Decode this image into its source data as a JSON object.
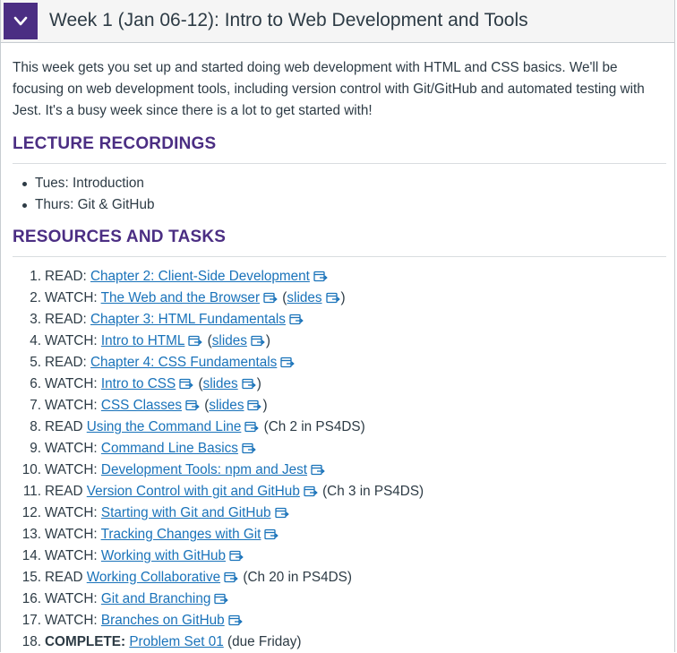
{
  "module": {
    "title": "Week 1 (Jan 06-12): Intro to Web Development and Tools",
    "intro": "This week gets you set up and started doing web development with HTML and CSS basics. We'll be focusing on web development tools, including version control with Git/GitHub and automated testing with Jest. It's a busy week since there is a lot to get started with!"
  },
  "lecture": {
    "heading": "LECTURE RECORDINGS",
    "items": [
      "Tues: Introduction",
      "Thurs: Git & GitHub"
    ]
  },
  "resources": {
    "heading": "RESOURCES AND TASKS",
    "items": [
      {
        "num": "1.",
        "prefix": "READ: ",
        "link": "Chapter 2: Client-Side Development",
        "slides": null,
        "suffix": ""
      },
      {
        "num": "2.",
        "prefix": "WATCH: ",
        "link": "The Web and the Browser",
        "slides": "slides",
        "suffix": ""
      },
      {
        "num": "3.",
        "prefix": "READ: ",
        "link": "Chapter 3: HTML Fundamentals",
        "slides": null,
        "suffix": ""
      },
      {
        "num": "4.",
        "prefix": "WATCH: ",
        "link": "Intro to HTML",
        "slides": "slides",
        "suffix": ""
      },
      {
        "num": "5.",
        "prefix": "READ: ",
        "link": "Chapter 4: CSS Fundamentals",
        "slides": null,
        "suffix": ""
      },
      {
        "num": "6.",
        "prefix": "WATCH: ",
        "link": "Intro to CSS",
        "slides": "slides",
        "suffix": ""
      },
      {
        "num": "7.",
        "prefix": "WATCH: ",
        "link": "CSS Classes",
        "slides": "slides",
        "suffix": ""
      },
      {
        "num": "8.",
        "prefix": "READ ",
        "link": "Using the Command Line",
        "slides": null,
        "suffix": "(Ch 2 in PS4DS)"
      },
      {
        "num": "9.",
        "prefix": "WATCH: ",
        "link": "Command Line Basics",
        "slides": null,
        "suffix": ""
      },
      {
        "num": "10.",
        "prefix": "WATCH: ",
        "link": "Development Tools: npm and Jest",
        "slides": null,
        "suffix": ""
      },
      {
        "num": "11.",
        "prefix": "READ ",
        "link": "Version Control with git and GitHub",
        "slides": null,
        "suffix": "(Ch 3 in PS4DS)"
      },
      {
        "num": "12.",
        "prefix": "WATCH: ",
        "link": "Starting with Git and GitHub",
        "slides": null,
        "suffix": ""
      },
      {
        "num": "13.",
        "prefix": "WATCH: ",
        "link": "Tracking Changes with Git",
        "slides": null,
        "suffix": ""
      },
      {
        "num": "14.",
        "prefix": "WATCH: ",
        "link": "Working with GitHub",
        "slides": null,
        "suffix": ""
      },
      {
        "num": "15.",
        "prefix": "READ ",
        "link": "Working Collaborative",
        "slides": null,
        "suffix": "(Ch 20 in PS4DS)"
      },
      {
        "num": "16.",
        "prefix": "WATCH: ",
        "link": "Git and Branching",
        "slides": null,
        "suffix": ""
      },
      {
        "num": "17.",
        "prefix": "WATCH: ",
        "link": "Branches on GitHub",
        "slides": null,
        "suffix": ""
      },
      {
        "num": "18.",
        "prefix": "COMPLETE: ",
        "bold_prefix": true,
        "link": "Problem Set 01",
        "slides": null,
        "suffix": "(due Friday)",
        "no_ext": true
      }
    ]
  },
  "colors": {
    "accent": "#4b2e83",
    "link": "#1a73ba",
    "text": "#2d3b45"
  },
  "icons": {
    "toggle": "chevron-down-icon",
    "external": "external-link-icon"
  }
}
